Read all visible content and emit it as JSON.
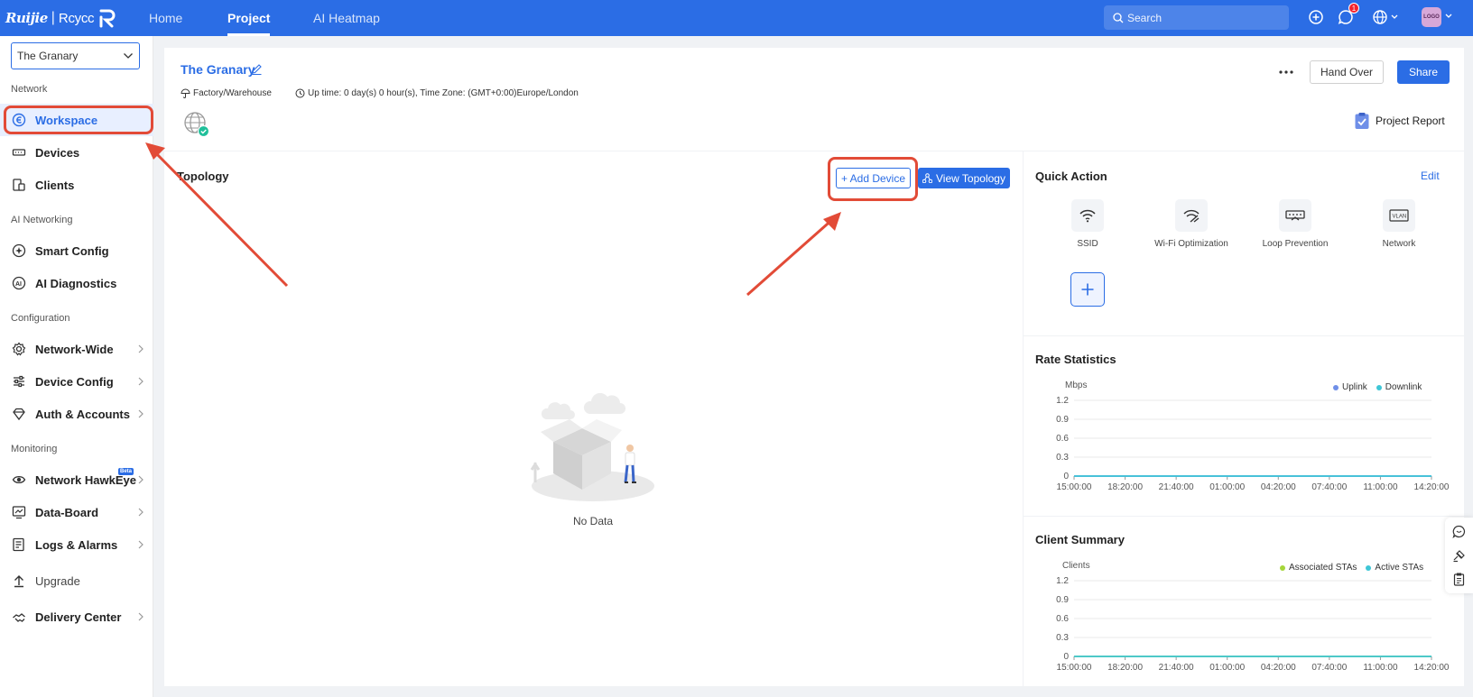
{
  "topbar": {
    "brand": "Ruijie",
    "brand2": "Rcycc",
    "nav": [
      {
        "label": "Home"
      },
      {
        "label": "Project"
      },
      {
        "label": "AI Heatmap"
      }
    ],
    "search_placeholder": "Search",
    "notification_count": "1",
    "avatar_text": "LOGO"
  },
  "sidebar": {
    "project_select": "The Granary",
    "sections": {
      "network": "Network",
      "ai": "AI Networking",
      "config": "Configuration",
      "monitoring": "Monitoring"
    },
    "items": {
      "workspace": "Workspace",
      "devices": "Devices",
      "clients": "Clients",
      "smart_config": "Smart Config",
      "ai_diagnostics": "AI Diagnostics",
      "network_wide": "Network-Wide",
      "device_config": "Device Config",
      "auth_accounts": "Auth & Accounts",
      "network_hawkeye": "Network HawkEye",
      "hawkeye_badge": "Beta",
      "data_board": "Data-Board",
      "logs_alarms": "Logs & Alarms",
      "upgrade": "Upgrade",
      "delivery_center": "Delivery Center"
    }
  },
  "project": {
    "name": "The Granary",
    "type": "Factory/Warehouse",
    "uptime": "Up time: 0 day(s) 0 hour(s), Time Zone: (GMT+0:00)Europe/London",
    "hand_over": "Hand Over",
    "share": "Share",
    "report": "Project Report"
  },
  "topology": {
    "title": "Topology",
    "add_device": "+ Add Device",
    "view_topology": "View Topology",
    "empty_text": "No Data"
  },
  "quick_action": {
    "title": "Quick Action",
    "edit": "Edit",
    "items": [
      "SSID",
      "Wi-Fi Optimization",
      "Loop Prevention",
      "Network"
    ],
    "vlan_label": "VLAN"
  },
  "chart_data": [
    {
      "type": "line",
      "title": "Rate Statistics",
      "ylabel": "Mbps",
      "x": [
        "15:00:00",
        "18:20:00",
        "21:40:00",
        "01:00:00",
        "04:20:00",
        "07:40:00",
        "11:00:00",
        "14:20:00"
      ],
      "y_ticks": [
        "1.2",
        "0.9",
        "0.6",
        "0.3",
        "0"
      ],
      "ylim": [
        0,
        1.2
      ],
      "series": [
        {
          "name": "Uplink",
          "color": "#6f8fe8",
          "values": [
            0,
            0,
            0,
            0,
            0,
            0,
            0,
            0
          ]
        },
        {
          "name": "Downlink",
          "color": "#3ec6d6",
          "values": [
            0,
            0,
            0,
            0,
            0,
            0,
            0,
            0
          ]
        }
      ],
      "grid": true,
      "legend": "top-right"
    },
    {
      "type": "line",
      "title": "Client Summary",
      "ylabel": "Clients",
      "x": [
        "15:00:00",
        "18:20:00",
        "21:40:00",
        "01:00:00",
        "04:20:00",
        "07:40:00",
        "11:00:00",
        "14:20:00"
      ],
      "y_ticks": [
        "1.2",
        "0.9",
        "0.6",
        "0.3",
        "0"
      ],
      "ylim": [
        0,
        1.2
      ],
      "series": [
        {
          "name": "Associated STAs",
          "color": "#a5d63a",
          "values": [
            0,
            0,
            0,
            0,
            0,
            0,
            0,
            0
          ]
        },
        {
          "name": "Active STAs",
          "color": "#3ec6d6",
          "values": [
            0,
            0,
            0,
            0,
            0,
            0,
            0,
            0
          ]
        }
      ],
      "grid": true,
      "legend": "top-right"
    }
  ]
}
